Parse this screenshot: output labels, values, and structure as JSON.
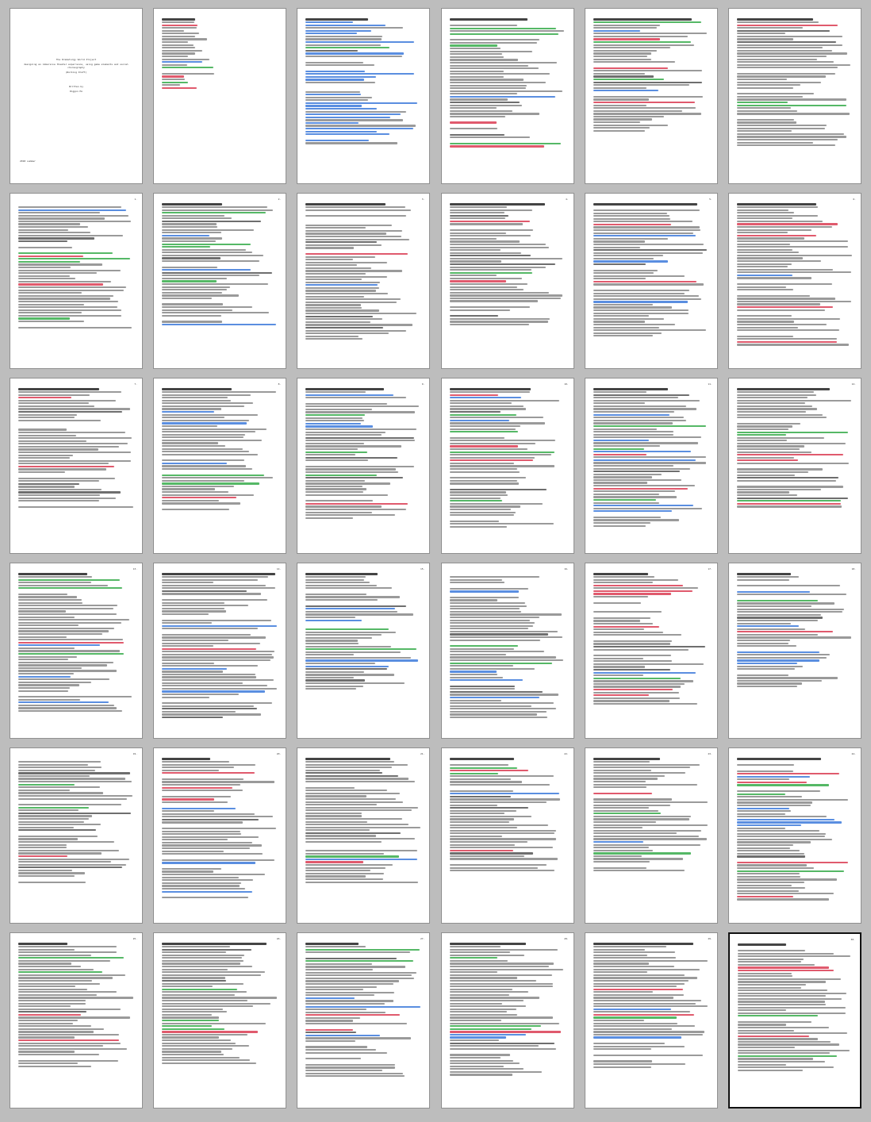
{
  "document": {
    "title": "The Dramaturgy World Project",
    "subtitle": "designing an immersive theater experience, using game elements and social choreography",
    "status": "(Working Draft)",
    "written_by": "Written by",
    "author": "Diggon Ho",
    "year": "2018 summer"
  },
  "pages": [
    {
      "num": "",
      "kind": "title"
    },
    {
      "num": "",
      "kind": "toc"
    },
    {
      "num": "",
      "kind": "toc2"
    },
    {
      "num": "",
      "kind": "text"
    },
    {
      "num": "",
      "kind": "text"
    },
    {
      "num": "",
      "kind": "text"
    },
    {
      "num": "1.",
      "kind": "text"
    },
    {
      "num": "2.",
      "kind": "text"
    },
    {
      "num": "3.",
      "kind": "text"
    },
    {
      "num": "4.",
      "kind": "text"
    },
    {
      "num": "5.",
      "kind": "text"
    },
    {
      "num": "6.",
      "kind": "text"
    },
    {
      "num": "7.",
      "kind": "text"
    },
    {
      "num": "8.",
      "kind": "text"
    },
    {
      "num": "9.",
      "kind": "text"
    },
    {
      "num": "10.",
      "kind": "text"
    },
    {
      "num": "11.",
      "kind": "text"
    },
    {
      "num": "12.",
      "kind": "text"
    },
    {
      "num": "13.",
      "kind": "text"
    },
    {
      "num": "14.",
      "kind": "text"
    },
    {
      "num": "15.",
      "kind": "text"
    },
    {
      "num": "16.",
      "kind": "text"
    },
    {
      "num": "17.",
      "kind": "text"
    },
    {
      "num": "18.",
      "kind": "text"
    },
    {
      "num": "19.",
      "kind": "text"
    },
    {
      "num": "20.",
      "kind": "text"
    },
    {
      "num": "21.",
      "kind": "text"
    },
    {
      "num": "22.",
      "kind": "text"
    },
    {
      "num": "23.",
      "kind": "text"
    },
    {
      "num": "24.",
      "kind": "text"
    },
    {
      "num": "25.",
      "kind": "text"
    },
    {
      "num": "26.",
      "kind": "text"
    },
    {
      "num": "27.",
      "kind": "text"
    },
    {
      "num": "28.",
      "kind": "text"
    },
    {
      "num": "29.",
      "kind": "text"
    },
    {
      "num": "30.",
      "kind": "text"
    }
  ],
  "selected_page_index": 35
}
